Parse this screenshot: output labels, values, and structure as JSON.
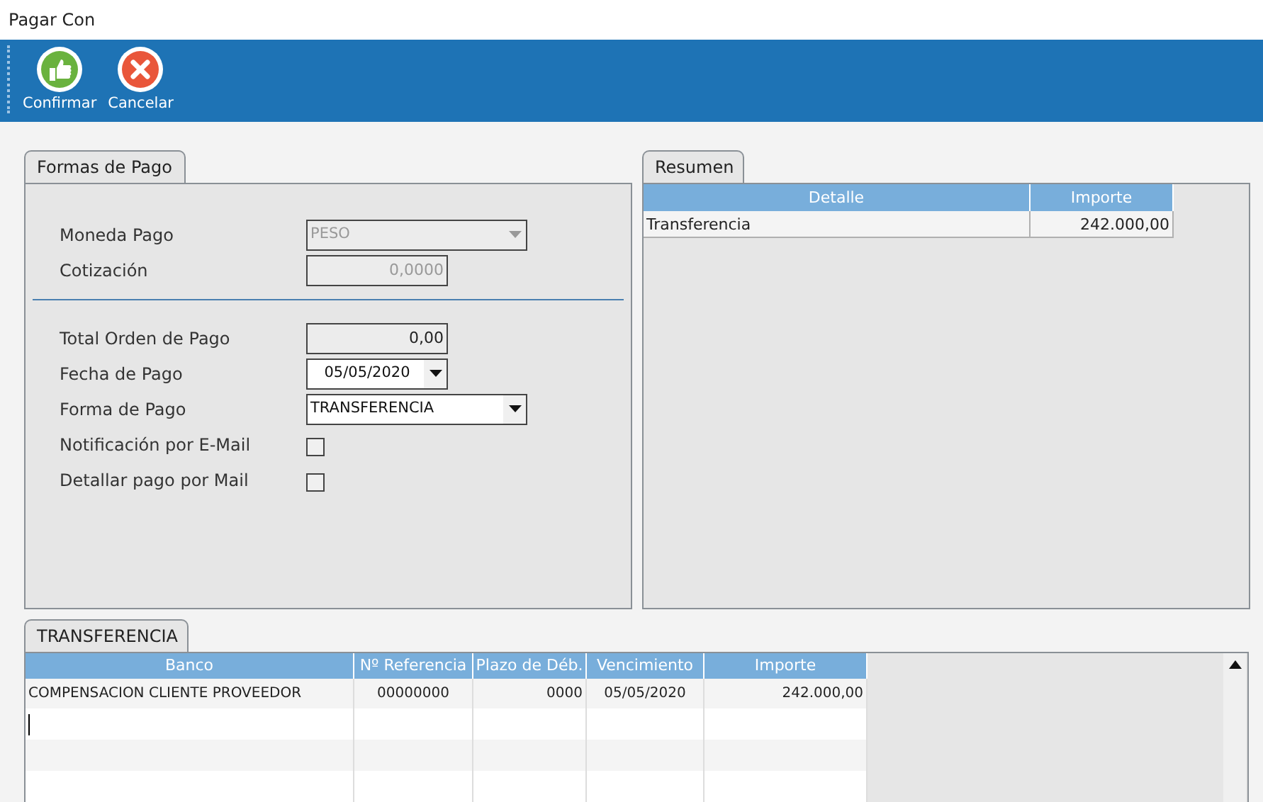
{
  "window": {
    "title": "Pagar Con"
  },
  "toolbar": [
    {
      "label": "Confirmar",
      "kind": "confirm"
    },
    {
      "label": "Cancelar",
      "kind": "cancel"
    }
  ],
  "formas_de_pago": {
    "tab": "Formas de Pago",
    "fields_top": [
      {
        "label": "Moneda Pago",
        "kind": "dropdown",
        "value": "PESO",
        "disabled": true
      },
      {
        "label": "Cotización",
        "kind": "number",
        "value": "0,0000",
        "disabled": true
      }
    ],
    "fields": [
      {
        "label": "Total Orden de Pago",
        "kind": "number",
        "value": "0,00",
        "disabled": false
      },
      {
        "label": "Fecha de Pago",
        "kind": "date",
        "value": "05/05/2020",
        "disabled": false
      },
      {
        "label": "Forma de Pago",
        "kind": "dropdown",
        "value": "TRANSFERENCIA",
        "disabled": false
      },
      {
        "label": "Notificación por E-Mail",
        "kind": "checkbox",
        "checked": false
      },
      {
        "label": "Detallar pago por Mail",
        "kind": "checkbox",
        "checked": false
      }
    ]
  },
  "resumen": {
    "tab": "Resumen",
    "columns": [
      "Detalle",
      "Importe"
    ],
    "rows": [
      [
        "Transferencia",
        "242.000,00"
      ]
    ]
  },
  "transferencia": {
    "tab": "TRANSFERENCIA",
    "columns": [
      "Banco",
      "Nº Referencia",
      "Plazo de Déb.",
      "Vencimiento",
      "Importe"
    ],
    "rows": [
      [
        "COMPENSACION CLIENTE PROVEEDOR",
        "00000000",
        "0000",
        "05/05/2020",
        "242.000,00"
      ]
    ]
  }
}
